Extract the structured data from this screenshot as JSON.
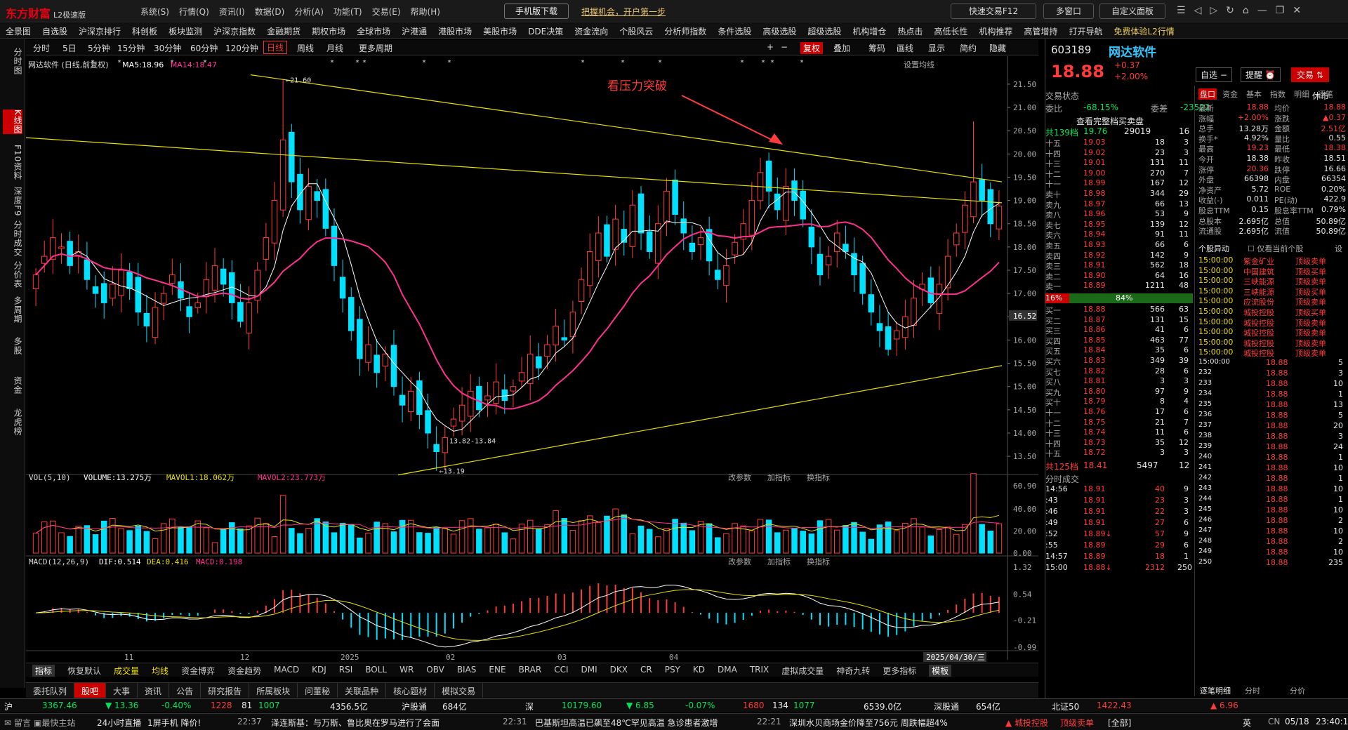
{
  "app": {
    "logo": "东方财富",
    "edition": "L2极速版",
    "menus": [
      "系统(S)",
      "行情(Q)",
      "资讯(I)",
      "数据(D)",
      "分析(A)",
      "功能(T)",
      "交易(E)",
      "帮助(H)"
    ],
    "mobile_btn": "手机版下载",
    "promo": "把握机会，开户第一步",
    "quick_trade": "快速交易F12",
    "multi_window": "多窗口",
    "custom_ui": "自定义面板"
  },
  "nav": [
    "全景图",
    "自选股",
    "沪深京排行",
    "科创板",
    "板块监测",
    "沪深京指数",
    "金融期货",
    "期权市场",
    "全球市场",
    "沪港通",
    "港股市场",
    "美股市场",
    "DDE决策",
    "资金流向",
    "个股风云",
    "分析师指数",
    "条件选股",
    "高级选股",
    "超级选股",
    "机构增仓",
    "热点击",
    "高低长性",
    "机构推荐",
    "高管增持",
    "打开导航",
    "免费体验L2行情"
  ],
  "leftbar": [
    "分时图",
    "K线图",
    "F10资料",
    "深度F9",
    "分时成交",
    "分价表",
    "多周期",
    "多股",
    "资金",
    "龙虎榜"
  ],
  "periods": [
    "分时",
    "5日",
    "5分钟",
    "15分钟",
    "30分钟",
    "60分钟",
    "120分钟",
    "日线",
    "周线",
    "月线",
    "更多周期"
  ],
  "chart_tools": [
    "复权",
    "叠加",
    "筹码",
    "画线",
    "显示",
    "简约",
    "隐藏"
  ],
  "chart_info": {
    "name": "网达软件",
    "mode": "(日线,前复权)",
    "ma5": "MA5:18.96",
    "ma14": "MA14:18.47",
    "setting": "设置均线"
  },
  "annotation": "看压力突破",
  "price_labels": {
    "high": "21.60",
    "low": "13.19",
    "range": "13.82-13.84",
    "current": "16.52"
  },
  "vol_info": {
    "title": "VOL(5,10)",
    "volume": "VOLUME:13.275万",
    "mavol1": "MAVOL1:18.062万",
    "mavol2": "MAVOL2:23.773万"
  },
  "macd_info": {
    "title": "MACD(12,26,9)",
    "dif": "DIF:0.514",
    "dea": "DEA:0.416",
    "macd": "MACD:0.198"
  },
  "panel_btns": [
    "改参数",
    "加指标",
    "换指标"
  ],
  "x_labels": [
    "11",
    "12",
    "2025",
    "02",
    "03",
    "04"
  ],
  "date_label": "2025/04/30/三",
  "indicators": [
    "指标",
    "恢复默认",
    "成交量",
    "均线",
    "资金博弈",
    "资金趋势",
    "MACD",
    "KDJ",
    "RSI",
    "BOLL",
    "WR",
    "OBV",
    "BIAS",
    "ENE",
    "BRAR",
    "CCI",
    "DMI",
    "DKX",
    "CR",
    "PSY",
    "KD",
    "DMA",
    "TRIX",
    "虚拟成交量",
    "神奇九转",
    "更多指标",
    "模板"
  ],
  "bottom_tabs": [
    "委托队列",
    "股吧",
    "大事",
    "资讯",
    "公告",
    "研究报告",
    "所属板块",
    "问董秘",
    "关联品种",
    "核心题材",
    "模拟交易"
  ],
  "stock": {
    "code": "603189",
    "name": "网达软件",
    "price": "18.88",
    "change": "+0.37",
    "pct": "+2.00%",
    "self_select": "自选",
    "remind": "提醒",
    "trade": "交易"
  },
  "quote_header": {
    "status": "交易状态",
    "halt": "休市",
    "wb_label": "委比",
    "wb": "-68.15%",
    "wc_label": "委差",
    "wc": "-23522",
    "full": "查看完整档买卖盘",
    "sell_total_label": "共139档",
    "sell_total_price": "19.76",
    "sell_total_vol": "29019",
    "sell_total_n": "16",
    "buy_total_label": "共125档",
    "buy_total_price": "18.41",
    "buy_total_vol": "5497",
    "buy_total_n": "12",
    "ratio_left": "16%",
    "ratio_right": "84%"
  },
  "asks": [
    [
      "十五",
      "19.03",
      "18",
      "3"
    ],
    [
      "十四",
      "19.02",
      "23",
      "3"
    ],
    [
      "十三",
      "19.01",
      "131",
      "11"
    ],
    [
      "十二",
      "19.00",
      "270",
      "7"
    ],
    [
      "十一",
      "18.99",
      "167",
      "12"
    ],
    [
      "卖十",
      "18.98",
      "344",
      "29"
    ],
    [
      "卖九",
      "18.97",
      "66",
      "13"
    ],
    [
      "卖八",
      "18.96",
      "53",
      "9"
    ],
    [
      "卖七",
      "18.95",
      "139",
      "12"
    ],
    [
      "卖六",
      "18.94",
      "91",
      "11"
    ],
    [
      "卖五",
      "18.93",
      "66",
      "6"
    ],
    [
      "卖四",
      "18.92",
      "142",
      "9"
    ],
    [
      "卖三",
      "18.91",
      "562",
      "18"
    ],
    [
      "卖二",
      "18.90",
      "64",
      "16"
    ],
    [
      "卖一",
      "18.89",
      "1211",
      "48"
    ]
  ],
  "bids": [
    [
      "买一",
      "18.88",
      "566",
      "63"
    ],
    [
      "买二",
      "18.87",
      "131",
      "15"
    ],
    [
      "买三",
      "18.86",
      "41",
      "6"
    ],
    [
      "买四",
      "18.85",
      "463",
      "77"
    ],
    [
      "买五",
      "18.84",
      "35",
      "6"
    ],
    [
      "买六",
      "18.83",
      "349",
      "39"
    ],
    [
      "买七",
      "18.82",
      "28",
      "6"
    ],
    [
      "买八",
      "18.81",
      "3",
      "3"
    ],
    [
      "买九",
      "18.80",
      "97",
      "9"
    ],
    [
      "买十",
      "18.79",
      "8",
      "4"
    ],
    [
      "十一",
      "18.76",
      "17",
      "6"
    ],
    [
      "十二",
      "18.75",
      "21",
      "7"
    ],
    [
      "十三",
      "18.74",
      "11",
      "6"
    ],
    [
      "十四",
      "18.73",
      "35",
      "12"
    ],
    [
      "十五",
      "18.72",
      "3",
      "3"
    ]
  ],
  "tabs2": [
    "盘口",
    "资金",
    "基本",
    "指数",
    "明细",
    "逐笔"
  ],
  "stats": [
    [
      "最新",
      "18.88",
      "均价",
      "18.88"
    ],
    [
      "涨幅",
      "+2.00%",
      "涨跌",
      "▲0.37"
    ],
    [
      "总手",
      "13.28万",
      "金额",
      "2.51亿"
    ],
    [
      "换手*",
      "4.92%",
      "量比",
      "0.55"
    ],
    [
      "最高",
      "19.23",
      "最低",
      "18.38"
    ],
    [
      "今开",
      "18.38",
      "昨收",
      "18.51"
    ],
    [
      "涨停",
      "20.36",
      "跌停",
      "16.66"
    ],
    [
      "外盘",
      "66398",
      "内盘",
      "66354"
    ],
    [
      "净资产",
      "5.72",
      "ROE",
      "0.20%"
    ],
    [
      "收益(-)",
      "0.011",
      "PE(动)",
      "422.9"
    ],
    [
      "股息TTM",
      "0.15",
      "股息率TTM",
      "0.79%"
    ],
    [
      "总股本",
      "2.695亿",
      "总值",
      "50.89亿"
    ],
    [
      "流通股",
      "2.695亿",
      "流值",
      "50.89亿"
    ]
  ],
  "movers_title": "个股异动",
  "movers_filter": "仅看当前个股",
  "movers_setting": "设",
  "movers": [
    [
      "15:00:00",
      "紫金矿业",
      "顶级卖单"
    ],
    [
      "15:00:00",
      "中国建筑",
      "顶级买单"
    ],
    [
      "15:00:00",
      "三峡能源",
      "顶级卖单"
    ],
    [
      "15:00:00",
      "三峡能源",
      "顶级买单"
    ],
    [
      "15:00:00",
      "应流股份",
      "顶级卖单"
    ],
    [
      "15:00:00",
      "城投控股",
      "顶级买单"
    ],
    [
      "15:00:00",
      "城投控股",
      "顶级卖单"
    ],
    [
      "15:00:00",
      "城投控股",
      "顶级卖单"
    ],
    [
      "15:00:00",
      "城投控股",
      "顶级卖单"
    ],
    [
      "15:00:00",
      "城投控股",
      "顶级卖单"
    ]
  ],
  "ticks_title": "分时成交",
  "ticks": [
    [
      "14:56",
      "18.91",
      "40",
      "9"
    ],
    [
      ":43",
      "18.91",
      "23",
      "3"
    ],
    [
      ":46",
      "18.91",
      "22",
      "3"
    ],
    [
      ":49",
      "18.91",
      "27",
      "6"
    ],
    [
      ":52",
      "18.89↓",
      "57",
      "9"
    ],
    [
      ":55",
      "18.89",
      "29",
      "6"
    ],
    [
      "14:57",
      "18.89",
      "18",
      "1"
    ],
    [
      "15:00",
      "18.88↓",
      "2312",
      "250"
    ]
  ],
  "deals": [
    [
      "15:00:00",
      "18.88",
      "5"
    ],
    [
      "232",
      "18.88",
      "3"
    ],
    [
      "233",
      "18.88",
      "10"
    ],
    [
      "234",
      "18.88",
      "1"
    ],
    [
      "235",
      "18.88",
      "13"
    ],
    [
      "236",
      "18.88",
      "5"
    ],
    [
      "237",
      "18.88",
      "20"
    ],
    [
      "238",
      "18.88",
      "3"
    ],
    [
      "239",
      "18.88",
      "24"
    ],
    [
      "240",
      "18.88",
      "1"
    ],
    [
      "241",
      "18.88",
      "10"
    ],
    [
      "242",
      "18.88",
      "1"
    ],
    [
      "243",
      "18.88",
      "10"
    ],
    [
      "244",
      "18.88",
      "1"
    ],
    [
      "245",
      "18.88",
      "10"
    ],
    [
      "246",
      "18.88",
      "2"
    ],
    [
      "247",
      "18.88",
      "10"
    ],
    [
      "248",
      "18.88",
      "2"
    ],
    [
      "249",
      "18.88",
      "10"
    ],
    [
      "250",
      "18.88",
      "235"
    ]
  ],
  "right_bottom_tabs": [
    "逐笔明细",
    "分时",
    "分价"
  ],
  "status": {
    "sh_label": "沪",
    "sh_val": "3367.46",
    "sh_chg": "▼ 13.36",
    "sh_pct": "-0.40%",
    "sh_up": "1228",
    "sh_flat": "81",
    "sh_dn": "1007",
    "sh_amt": "4356.5亿",
    "hgt_label": "沪股通",
    "hgt_val": "684亿",
    "sz_label": "深",
    "sz_val": "10179.60",
    "sz_chg": "▼ 6.85",
    "sz_pct": "-0.07%",
    "sz_up": "1680",
    "sz_flat": "134",
    "sz_dn": "1077",
    "sz_amt": "6539.0亿",
    "sgt_label": "深股通",
    "sgt_val": "654亿",
    "bz_label": "北证50",
    "bz_val": "1422.43",
    "bz_chg": "▲ 6.96"
  },
  "ticker": {
    "a": "留言",
    "b": "最快主站",
    "c": "24小时直播",
    "d": "1屏手机 降价!",
    "t1": "22:37",
    "n1": "泽连斯基：与万斯、鲁比奥在罗马进行了会面",
    "t2": "22:31",
    "n2": "巴基斯坦高温已飙至48℃罕见高温 急诊患者激增",
    "t3": "22:21",
    "n3": "深圳水贝商场金价降至756元 周跌幅超4%",
    "s1": "城投控股",
    "s2": "顶级卖单",
    "s3": "[全部]",
    "ime": "英",
    "cn": "CN",
    "date": "05/18",
    "time": "23:40:16"
  },
  "chart_data": {
    "type": "candlestick",
    "title": "网达软件 (日线,前复权)",
    "ylim": [
      13.2,
      21.8
    ],
    "yticks": [
      "21.50",
      "21.00",
      "20.50",
      "20.00",
      "19.50",
      "19.00",
      "18.50",
      "18.00",
      "17.50",
      "17.00",
      "16.50",
      "16.00",
      "15.50",
      "15.00",
      "14.50",
      "14.00",
      "13.50"
    ],
    "vol_ticks": [
      "60.90",
      "40.00",
      "20.00",
      "0.00"
    ],
    "macd_ticks": [
      "1.32",
      "0.54",
      "-0.21",
      "-0.99"
    ],
    "close": [
      17.4,
      17.8,
      18.2,
      18.0,
      17.6,
      17.9,
      17.3,
      17.0,
      16.8,
      17.2,
      17.5,
      17.1,
      16.6,
      16.3,
      16.7,
      17.0,
      17.4,
      16.9,
      16.5,
      16.8,
      17.3,
      17.6,
      17.2,
      16.8,
      16.4,
      16.8,
      17.5,
      18.2,
      19.0,
      20.3,
      19.4,
      18.8,
      19.3,
      19.0,
      18.4,
      17.6,
      16.9,
      16.2,
      15.6,
      15.9,
      15.3,
      15.7,
      15.0,
      14.6,
      14.9,
      14.4,
      14.0,
      13.6,
      13.9,
      14.3,
      14.6,
      14.9,
      14.5,
      14.8,
      15.1,
      14.7,
      15.0,
      15.3,
      15.7,
      15.4,
      15.9,
      16.3,
      16.0,
      16.6,
      17.3,
      17.9,
      18.3,
      17.8,
      18.6,
      18.1,
      18.9,
      18.3,
      17.9,
      18.5,
      19.2,
      18.7,
      18.3,
      17.9,
      18.2,
      17.7,
      17.3,
      17.6,
      18.1,
      18.5,
      19.0,
      19.6,
      19.2,
      18.8,
      19.3,
      19.0,
      18.6,
      18.0,
      17.4,
      17.8,
      18.3,
      17.9,
      17.4,
      17.0,
      16.6,
      16.2,
      15.8,
      16.2,
      16.5,
      16.9,
      17.2,
      16.8,
      17.2,
      17.8,
      18.3,
      18.9,
      19.4,
      19.0,
      18.5,
      18.88
    ],
    "annotation": "看压力突破",
    "price_high_label": "21.60",
    "price_low_label": "13.19"
  }
}
